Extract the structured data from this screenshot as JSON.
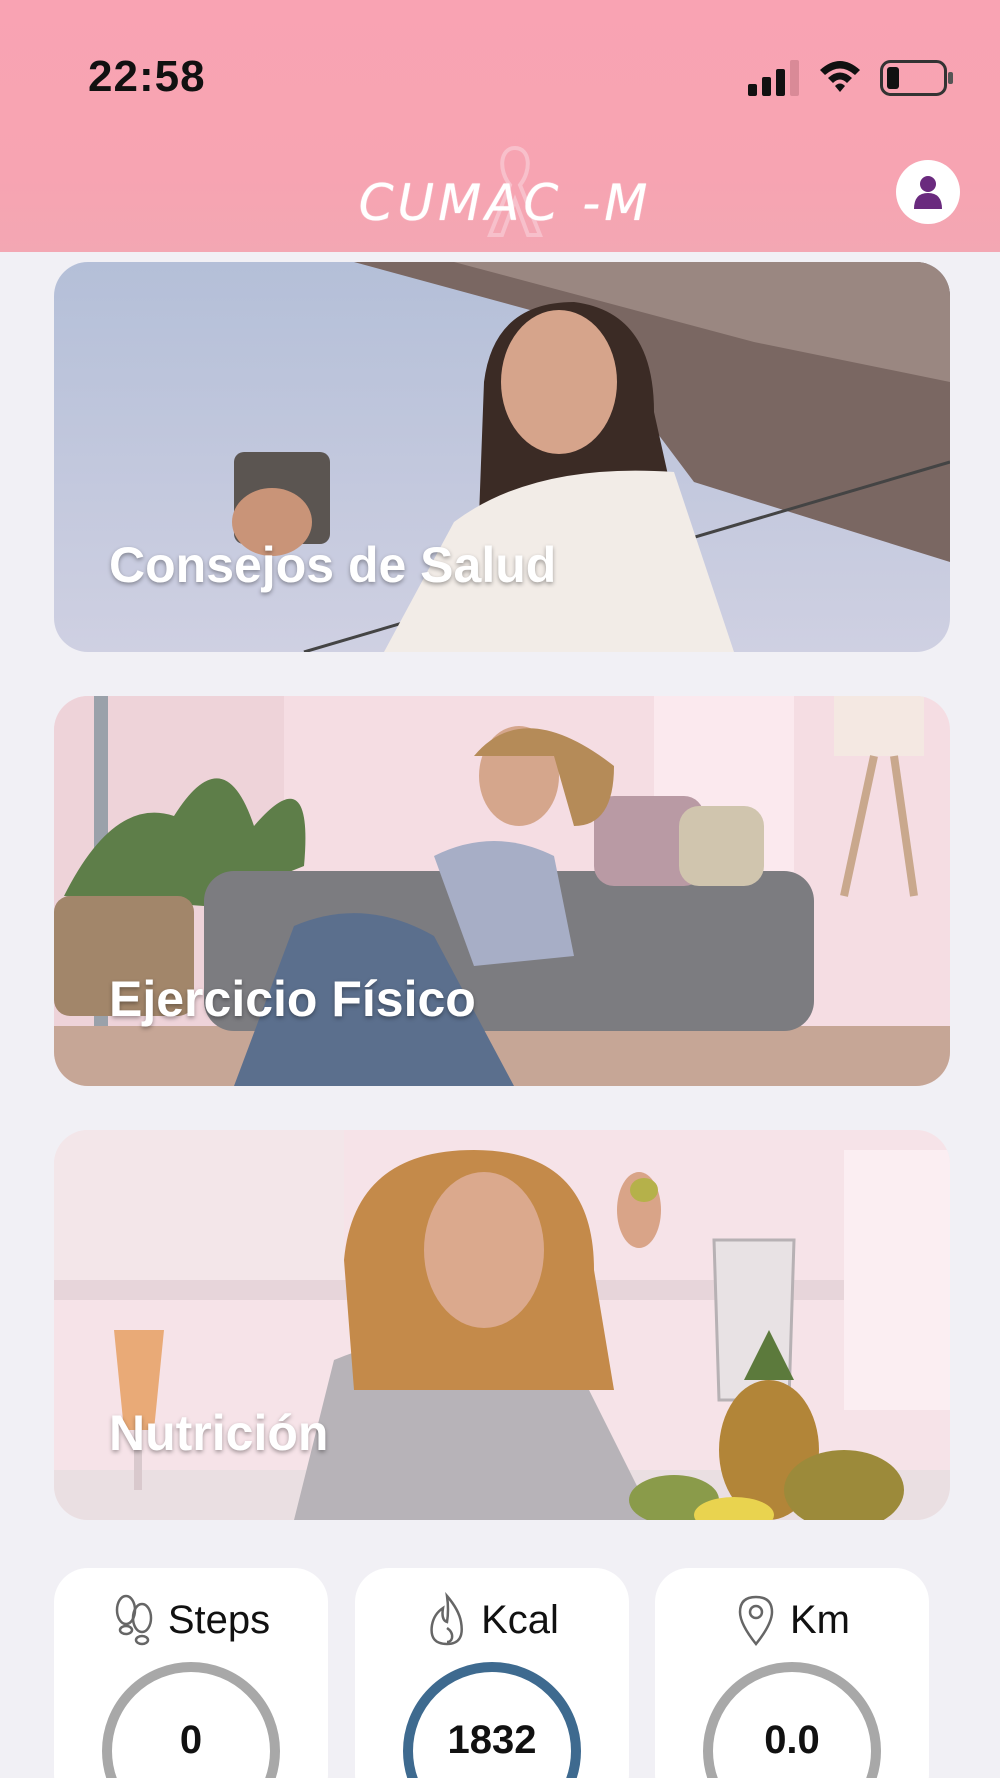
{
  "status_bar": {
    "time": "22:58"
  },
  "header": {
    "logo_text": "CUMAC -M"
  },
  "cards": [
    {
      "title": "Consejos de Salud"
    },
    {
      "title": "Ejercicio Físico"
    },
    {
      "title": "Nutrición"
    }
  ],
  "stats": [
    {
      "label": "Steps",
      "value": "0",
      "icon": "footprints-icon"
    },
    {
      "label": "Kcal",
      "value": "1832",
      "icon": "flame-icon"
    },
    {
      "label": "Km",
      "value": "0.0",
      "icon": "location-pin-icon"
    }
  ],
  "colors": {
    "header": "#f7a4b2",
    "background": "#f1f0f5",
    "profile_icon": "#6a2a7e",
    "kcal_ring": "#3e6a8f",
    "ring_gray": "#a8a8a8"
  }
}
